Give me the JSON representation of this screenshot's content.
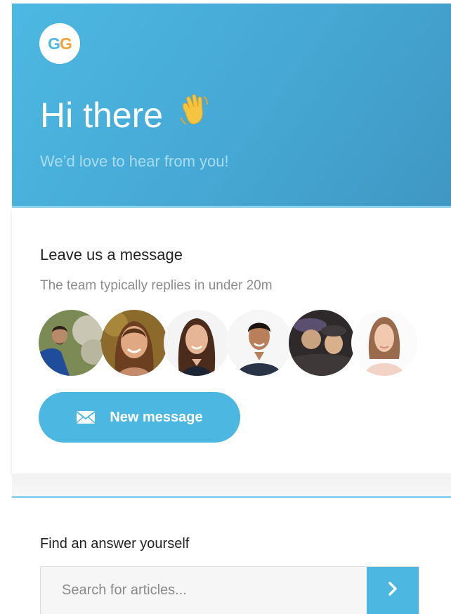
{
  "header": {
    "logo_text_1": "G",
    "logo_text_2": "G",
    "title": "Hi there",
    "subtitle": "We’d love to hear from you!",
    "wave_icon": "waving-hand-icon"
  },
  "message_card": {
    "title": "Leave us a message",
    "reply_time": "The team typically replies in under 20m",
    "avatars": [
      {
        "name": "team-avatar-1"
      },
      {
        "name": "team-avatar-2"
      },
      {
        "name": "team-avatar-3"
      },
      {
        "name": "team-avatar-4"
      },
      {
        "name": "team-avatar-5"
      },
      {
        "name": "team-avatar-6"
      }
    ],
    "button_label": "New message",
    "button_icon": "envelope-icon"
  },
  "help": {
    "title": "Find an answer yourself",
    "search_placeholder": "Search for articles...",
    "search_button_icon": "chevron-right-icon"
  },
  "colors": {
    "accent": "#4cb8e2",
    "header_end": "#3f97c2",
    "logo_g1": "#4cb8e2",
    "logo_g2": "#f0a23a"
  }
}
